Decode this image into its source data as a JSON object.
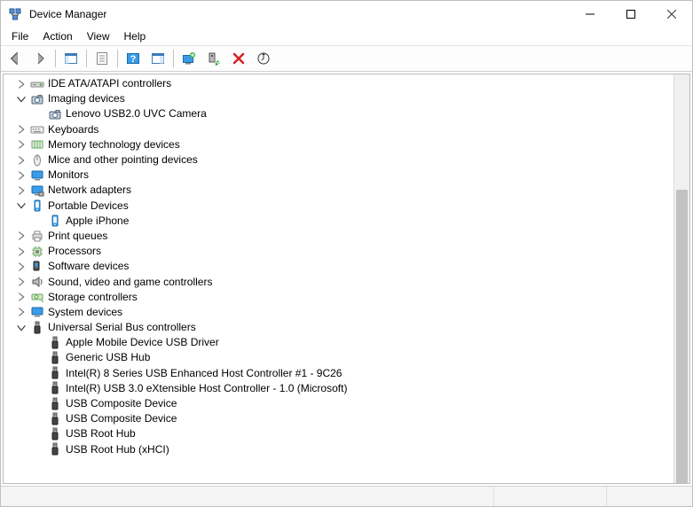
{
  "window": {
    "title": "Device Manager"
  },
  "menu": [
    "File",
    "Action",
    "View",
    "Help"
  ],
  "tree": [
    {
      "indent": 0,
      "twist": "closed",
      "icon": "ide",
      "label": "IDE ATA/ATAPI controllers"
    },
    {
      "indent": 0,
      "twist": "open",
      "icon": "camera",
      "label": "Imaging devices"
    },
    {
      "indent": 1,
      "twist": "",
      "icon": "camera",
      "label": "Lenovo USB2.0 UVC Camera"
    },
    {
      "indent": 0,
      "twist": "closed",
      "icon": "keyboard",
      "label": "Keyboards"
    },
    {
      "indent": 0,
      "twist": "closed",
      "icon": "memory",
      "label": "Memory technology devices"
    },
    {
      "indent": 0,
      "twist": "closed",
      "icon": "mouse",
      "label": "Mice and other pointing devices"
    },
    {
      "indent": 0,
      "twist": "closed",
      "icon": "monitor",
      "label": "Monitors"
    },
    {
      "indent": 0,
      "twist": "closed",
      "icon": "network",
      "label": "Network adapters"
    },
    {
      "indent": 0,
      "twist": "open",
      "icon": "portable",
      "label": "Portable Devices"
    },
    {
      "indent": 1,
      "twist": "",
      "icon": "portable",
      "label": "Apple iPhone"
    },
    {
      "indent": 0,
      "twist": "closed",
      "icon": "printer",
      "label": "Print queues"
    },
    {
      "indent": 0,
      "twist": "closed",
      "icon": "cpu",
      "label": "Processors"
    },
    {
      "indent": 0,
      "twist": "closed",
      "icon": "software",
      "label": "Software devices"
    },
    {
      "indent": 0,
      "twist": "closed",
      "icon": "sound",
      "label": "Sound, video and game controllers"
    },
    {
      "indent": 0,
      "twist": "closed",
      "icon": "storage",
      "label": "Storage controllers"
    },
    {
      "indent": 0,
      "twist": "closed",
      "icon": "system",
      "label": "System devices"
    },
    {
      "indent": 0,
      "twist": "open",
      "icon": "usb",
      "label": "Universal Serial Bus controllers"
    },
    {
      "indent": 1,
      "twist": "",
      "icon": "usb",
      "label": "Apple Mobile Device USB Driver"
    },
    {
      "indent": 1,
      "twist": "",
      "icon": "usb",
      "label": "Generic USB Hub"
    },
    {
      "indent": 1,
      "twist": "",
      "icon": "usb",
      "label": "Intel(R) 8 Series USB Enhanced Host Controller #1 - 9C26"
    },
    {
      "indent": 1,
      "twist": "",
      "icon": "usb",
      "label": "Intel(R) USB 3.0 eXtensible Host Controller - 1.0 (Microsoft)"
    },
    {
      "indent": 1,
      "twist": "",
      "icon": "usb",
      "label": "USB Composite Device"
    },
    {
      "indent": 1,
      "twist": "",
      "icon": "usb",
      "label": "USB Composite Device"
    },
    {
      "indent": 1,
      "twist": "",
      "icon": "usb",
      "label": "USB Root Hub"
    },
    {
      "indent": 1,
      "twist": "",
      "icon": "usb",
      "label": "USB Root Hub (xHCI)"
    }
  ]
}
